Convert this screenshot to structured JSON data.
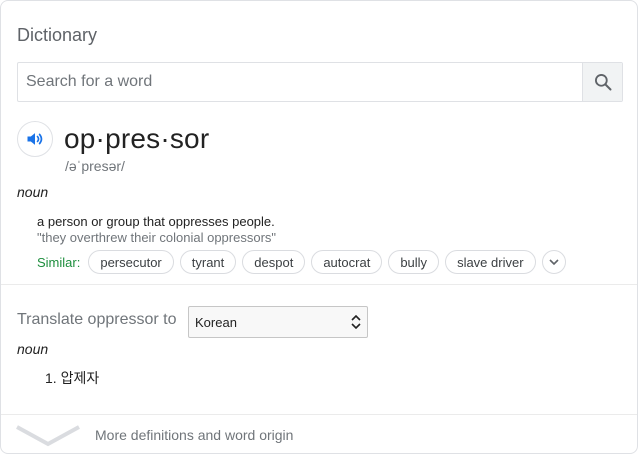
{
  "card": {
    "title": "Dictionary"
  },
  "search": {
    "placeholder": "Search for a word",
    "value": ""
  },
  "entry": {
    "headword": "op·pres·sor",
    "phonetic": "/əˈpresər/",
    "pos": "noun",
    "definition": "a person or group that oppresses people.",
    "example": "\"they overthrew their colonial oppressors\"",
    "similar_label": "Similar:",
    "similar": [
      "persecutor",
      "tyrant",
      "despot",
      "autocrat",
      "bully",
      "slave driver"
    ]
  },
  "translate": {
    "label": "Translate oppressor to",
    "language": "Korean",
    "pos": "noun",
    "items": [
      "1. 압제자"
    ]
  },
  "footer": {
    "more_label": "More definitions and word origin"
  },
  "colors": {
    "similar_green": "#1e8e3e",
    "speaker_blue": "#1a73e8",
    "search_icon": "#5f6368"
  },
  "icons": {
    "search": "search-icon",
    "speaker": "speaker-icon",
    "expand": "chevron-down-icon"
  }
}
